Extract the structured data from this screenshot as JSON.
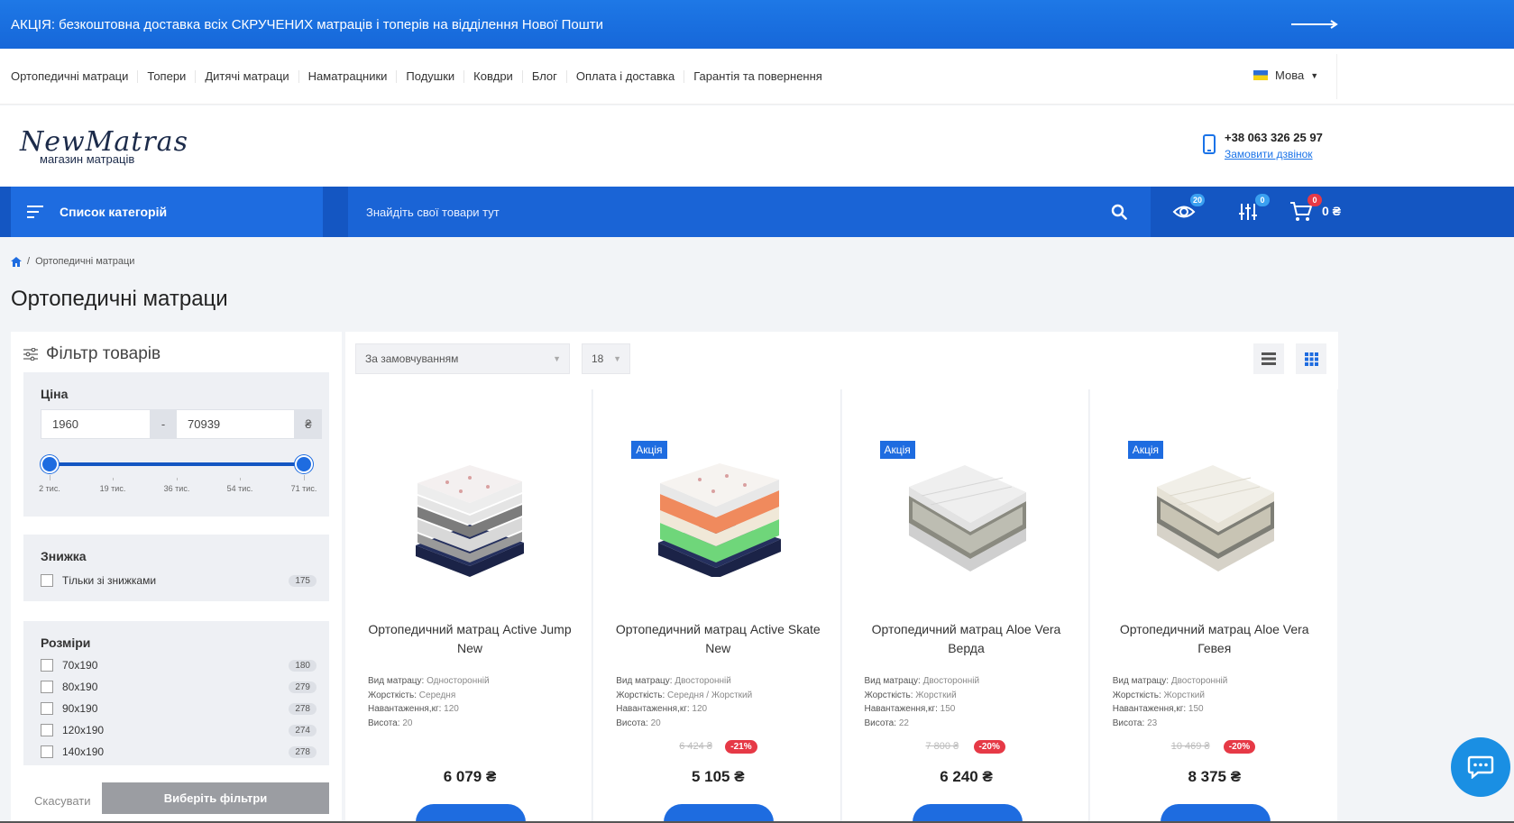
{
  "promo": {
    "text": "АКЦІЯ: безкоштовна доставка всіх СКРУЧЕНИХ матраців і топерів на відділення Нової Пошти",
    "icon": "arrow-right-icon"
  },
  "topnav": {
    "links": [
      "Ортопедичні матраци",
      "Топери",
      "Дитячі матраци",
      "Наматрацники",
      "Подушки",
      "Ковдри",
      "Блог",
      "Оплата і доставка",
      "Гарантія та повернення"
    ],
    "language_label": "Мова"
  },
  "header": {
    "logo_brand": "NewMatras",
    "logo_sub": "магазин матраців",
    "phone": "+38 063 326 25 97",
    "callback_label": "Замовити дзвінок"
  },
  "toolbar": {
    "categories_label": "Список категорій",
    "search_placeholder": "Знайдіть свої товари тут",
    "viewed_count": "20",
    "compare_count": "0",
    "cart_count": "0",
    "cart_total": "0 ₴",
    "accent": "#1456c2"
  },
  "breadcrumb": {
    "current": "Ортопедичні матраци"
  },
  "page_title": "Ортопедичні матраци",
  "filter": {
    "title": "Фільтр товарів",
    "price": {
      "label": "Ціна",
      "min": "1960",
      "max": "70939",
      "currency": "₴",
      "ticks": [
        "2 тис.",
        "19 тис.",
        "36 тис.",
        "54 тис.",
        "71 тис."
      ]
    },
    "discount": {
      "label": "Знижка",
      "option": "Тільки зі знижками",
      "count": "175"
    },
    "sizes": {
      "label": "Розміри",
      "options": [
        {
          "label": "70x190",
          "count": "180"
        },
        {
          "label": "80x190",
          "count": "279"
        },
        {
          "label": "90x190",
          "count": "278"
        },
        {
          "label": "120x190",
          "count": "274"
        },
        {
          "label": "140x190",
          "count": "278"
        }
      ]
    },
    "cancel_label": "Скасувати",
    "apply_label": "Виберіть фільтри"
  },
  "sorting": {
    "sort_value": "За замовчуванням",
    "per_page": "18"
  },
  "products": [
    {
      "name": "Ортопедичний матрац Active Jump New",
      "sale_badge": "",
      "specs": [
        [
          "Вид матрацу:",
          "Односторонній"
        ],
        [
          "Жорсткість:",
          "Середня"
        ],
        [
          "Навантаження,кг:",
          "120"
        ],
        [
          "Висота:",
          "20"
        ]
      ],
      "old_price": "",
      "discount": "",
      "price": "6 079 ₴"
    },
    {
      "name": "Ортопедичний матрац Active Skate New",
      "sale_badge": "Акція",
      "specs": [
        [
          "Вид матрацу:",
          "Двосторонній"
        ],
        [
          "Жорсткість:",
          "Середня / Жорсткий"
        ],
        [
          "Навантаження,кг:",
          "120"
        ],
        [
          "Висота:",
          "20"
        ]
      ],
      "old_price": "6 424 ₴",
      "discount": "-21%",
      "price": "5 105 ₴"
    },
    {
      "name": "Ортопедичний матрац Aloe Vera Верда",
      "sale_badge": "Акція",
      "specs": [
        [
          "Вид матрацу:",
          "Двосторонній"
        ],
        [
          "Жорсткість:",
          "Жорсткий"
        ],
        [
          "Навантаження,кг:",
          "150"
        ],
        [
          "Висота:",
          "22"
        ]
      ],
      "old_price": "7 800 ₴",
      "discount": "-20%",
      "price": "6 240 ₴"
    },
    {
      "name": "Ортопедичний матрац Aloe Vera Гевея",
      "sale_badge": "Акція",
      "specs": [
        [
          "Вид матрацу:",
          "Двосторонній"
        ],
        [
          "Жорсткість:",
          "Жорсткий"
        ],
        [
          "Навантаження,кг:",
          "150"
        ],
        [
          "Висота:",
          "23"
        ]
      ],
      "old_price": "10 469 ₴",
      "discount": "-20%",
      "price": "8 375 ₴"
    }
  ]
}
